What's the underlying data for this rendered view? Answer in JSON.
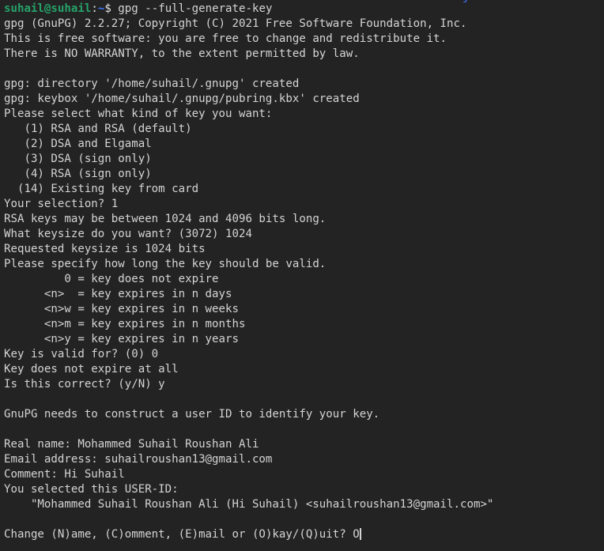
{
  "terminal": {
    "app": "gnome-terminal",
    "colors": {
      "background": "#232323",
      "foreground": "#d4d4d4",
      "prompt_user_host": "#26a269",
      "prompt_path": "#3b78ff",
      "prompt_punct": "#e6e6e6",
      "cursor": "#d4d4d4"
    },
    "scrolled_remnant": "j",
    "prompt": {
      "user_host": "suhail@suhail",
      "colon": ":",
      "path": "~",
      "symbol": "$ ",
      "command": "gpg --full-generate-key"
    },
    "lines": [
      "gpg (GnuPG) 2.2.27; Copyright (C) 2021 Free Software Foundation, Inc.",
      "This is free software: you are free to change and redistribute it.",
      "There is NO WARRANTY, to the extent permitted by law.",
      "",
      "gpg: directory '/home/suhail/.gnupg' created",
      "gpg: keybox '/home/suhail/.gnupg/pubring.kbx' created",
      "Please select what kind of key you want:",
      "   (1) RSA and RSA (default)",
      "   (2) DSA and Elgamal",
      "   (3) DSA (sign only)",
      "   (4) RSA (sign only)",
      "  (14) Existing key from card",
      "Your selection? 1",
      "RSA keys may be between 1024 and 4096 bits long.",
      "What keysize do you want? (3072) 1024",
      "Requested keysize is 1024 bits",
      "Please specify how long the key should be valid.",
      "         0 = key does not expire",
      "      <n>  = key expires in n days",
      "      <n>w = key expires in n weeks",
      "      <n>m = key expires in n months",
      "      <n>y = key expires in n years",
      "Key is valid for? (0) 0",
      "Key does not expire at all",
      "Is this correct? (y/N) y",
      "",
      "GnuPG needs to construct a user ID to identify your key.",
      "",
      "Real name: Mohammed Suhail Roushan Ali",
      "Email address: suhailroushan13@gmail.com",
      "Comment: Hi Suhail",
      "You selected this USER-ID:",
      "    \"Mohammed Suhail Roushan Ali (Hi Suhail) <suhailroushan13@gmail.com>\"",
      ""
    ],
    "final_prompt": "Change (N)ame, (C)omment, (E)mail or (O)kay/(Q)uit? O"
  }
}
